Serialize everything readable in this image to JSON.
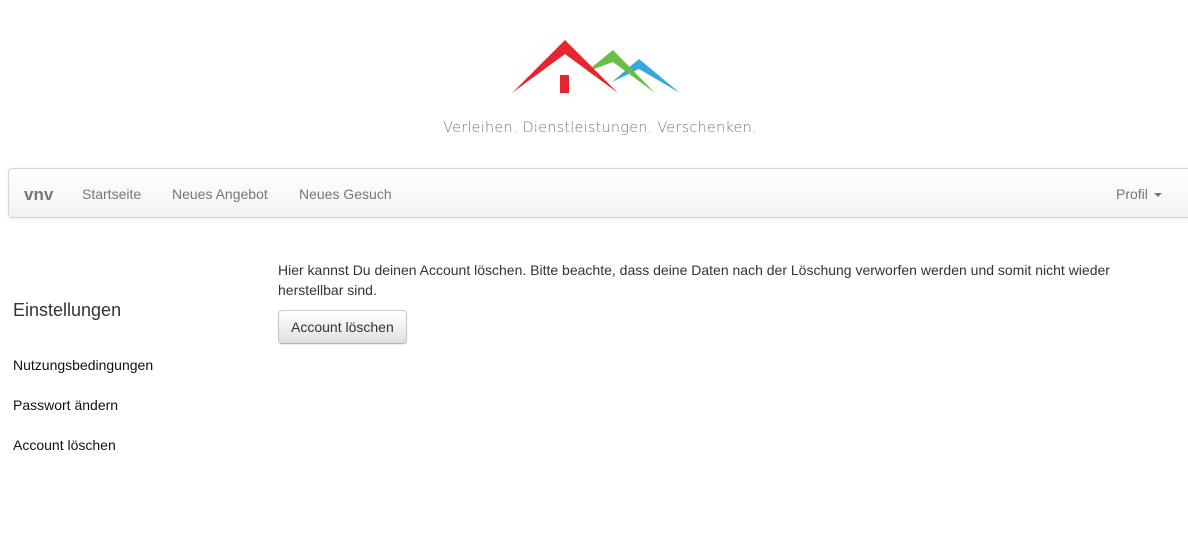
{
  "header": {
    "logo": "vnv-house-mountains-logo",
    "tagline": "Verleihen. Dienstleistungen. Verschenken.",
    "logo_colors": {
      "red": "#e8242f",
      "green": "#6cbd45",
      "blue": "#35a8e0"
    }
  },
  "navbar": {
    "brand": "vnv",
    "links": [
      {
        "label": "Startseite"
      },
      {
        "label": "Neues Angebot"
      },
      {
        "label": "Neues Gesuch"
      }
    ],
    "profile": {
      "label": "Profil",
      "icon": "caret-down-icon"
    }
  },
  "sidebar": {
    "title": "Einstellungen",
    "items": [
      {
        "label": "Nutzungsbedingungen"
      },
      {
        "label": "Passwort ändern"
      },
      {
        "label": "Account löschen"
      }
    ]
  },
  "main": {
    "text": "Hier kannst Du deinen Account löschen. Bitte beachte, dass deine Daten nach der Löschung verworfen werden und somit nicht wieder herstellbar sind.",
    "button_label": "Account löschen"
  }
}
